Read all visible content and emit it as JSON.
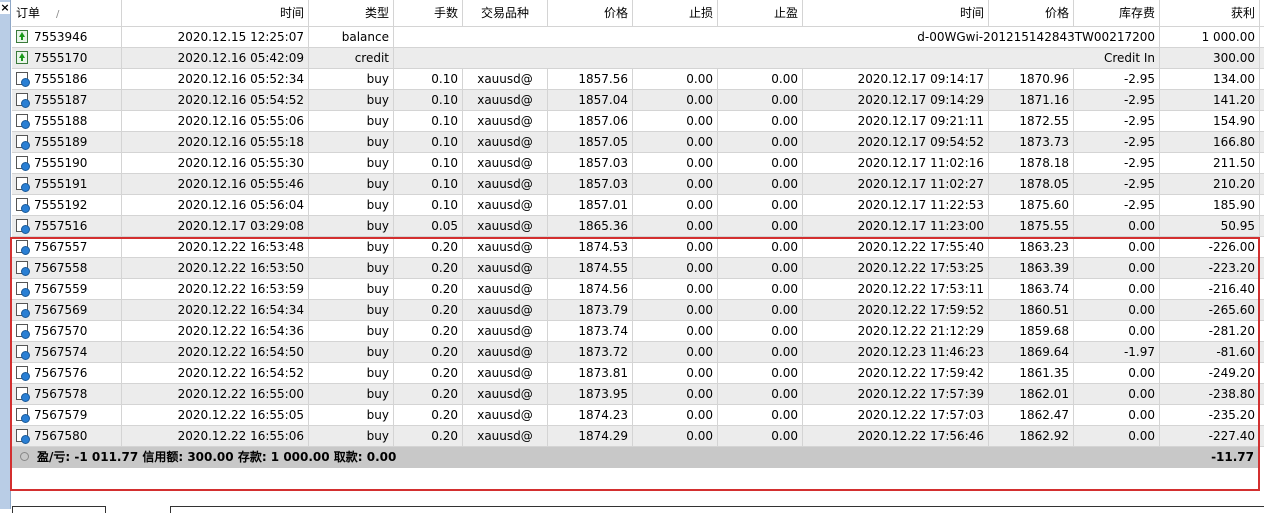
{
  "window": {
    "close_label": "×"
  },
  "columns": [
    "订单",
    "时间",
    "类型",
    "手数",
    "交易品种",
    "价格",
    "止损",
    "止盈",
    "时间",
    "价格",
    "库存费",
    "获利"
  ],
  "sort_indicator": "/",
  "rows": [
    {
      "icon": "deposit-icon",
      "order": "7553946",
      "time": "2020.12.15 12:25:07",
      "type": "balance",
      "comment": "d-00WGwi-201215142843TW00217200",
      "profit": "1 000.00"
    },
    {
      "icon": "deposit-icon",
      "order": "7555170",
      "time": "2020.12.16 05:42:09",
      "type": "credit",
      "comment": "Credit In",
      "profit": "300.00"
    },
    {
      "icon": "order-icon",
      "order": "7555186",
      "time": "2020.12.16 05:52:34",
      "type": "buy",
      "lots": "0.10",
      "symbol": "xauusd@",
      "price": "1857.56",
      "sl": "0.00",
      "tp": "0.00",
      "close_time": "2020.12.17 09:14:17",
      "close_price": "1870.96",
      "swap": "-2.95",
      "profit": "134.00"
    },
    {
      "icon": "order-icon",
      "order": "7555187",
      "time": "2020.12.16 05:54:52",
      "type": "buy",
      "lots": "0.10",
      "symbol": "xauusd@",
      "price": "1857.04",
      "sl": "0.00",
      "tp": "0.00",
      "close_time": "2020.12.17 09:14:29",
      "close_price": "1871.16",
      "swap": "-2.95",
      "profit": "141.20"
    },
    {
      "icon": "order-icon",
      "order": "7555188",
      "time": "2020.12.16 05:55:06",
      "type": "buy",
      "lots": "0.10",
      "symbol": "xauusd@",
      "price": "1857.06",
      "sl": "0.00",
      "tp": "0.00",
      "close_time": "2020.12.17 09:21:11",
      "close_price": "1872.55",
      "swap": "-2.95",
      "profit": "154.90"
    },
    {
      "icon": "order-icon",
      "order": "7555189",
      "time": "2020.12.16 05:55:18",
      "type": "buy",
      "lots": "0.10",
      "symbol": "xauusd@",
      "price": "1857.05",
      "sl": "0.00",
      "tp": "0.00",
      "close_time": "2020.12.17 09:54:52",
      "close_price": "1873.73",
      "swap": "-2.95",
      "profit": "166.80"
    },
    {
      "icon": "order-icon",
      "order": "7555190",
      "time": "2020.12.16 05:55:30",
      "type": "buy",
      "lots": "0.10",
      "symbol": "xauusd@",
      "price": "1857.03",
      "sl": "0.00",
      "tp": "0.00",
      "close_time": "2020.12.17 11:02:16",
      "close_price": "1878.18",
      "swap": "-2.95",
      "profit": "211.50"
    },
    {
      "icon": "order-icon",
      "order": "7555191",
      "time": "2020.12.16 05:55:46",
      "type": "buy",
      "lots": "0.10",
      "symbol": "xauusd@",
      "price": "1857.03",
      "sl": "0.00",
      "tp": "0.00",
      "close_time": "2020.12.17 11:02:27",
      "close_price": "1878.05",
      "swap": "-2.95",
      "profit": "210.20"
    },
    {
      "icon": "order-icon",
      "order": "7555192",
      "time": "2020.12.16 05:56:04",
      "type": "buy",
      "lots": "0.10",
      "symbol": "xauusd@",
      "price": "1857.01",
      "sl": "0.00",
      "tp": "0.00",
      "close_time": "2020.12.17 11:22:53",
      "close_price": "1875.60",
      "swap": "-2.95",
      "profit": "185.90"
    },
    {
      "icon": "order-icon",
      "order": "7557516",
      "time": "2020.12.17 03:29:08",
      "type": "buy",
      "lots": "0.05",
      "symbol": "xauusd@",
      "price": "1865.36",
      "sl": "0.00",
      "tp": "0.00",
      "close_time": "2020.12.17 11:23:00",
      "close_price": "1875.55",
      "swap": "0.00",
      "profit": "50.95"
    },
    {
      "icon": "order-icon",
      "order": "7567557",
      "time": "2020.12.22 16:53:48",
      "type": "buy",
      "lots": "0.20",
      "symbol": "xauusd@",
      "price": "1874.53",
      "sl": "0.00",
      "tp": "0.00",
      "close_time": "2020.12.22 17:55:40",
      "close_price": "1863.23",
      "swap": "0.00",
      "profit": "-226.00"
    },
    {
      "icon": "order-icon",
      "order": "7567558",
      "time": "2020.12.22 16:53:50",
      "type": "buy",
      "lots": "0.20",
      "symbol": "xauusd@",
      "price": "1874.55",
      "sl": "0.00",
      "tp": "0.00",
      "close_time": "2020.12.22 17:53:25",
      "close_price": "1863.39",
      "swap": "0.00",
      "profit": "-223.20"
    },
    {
      "icon": "order-icon",
      "order": "7567559",
      "time": "2020.12.22 16:53:59",
      "type": "buy",
      "lots": "0.20",
      "symbol": "xauusd@",
      "price": "1874.56",
      "sl": "0.00",
      "tp": "0.00",
      "close_time": "2020.12.22 17:53:11",
      "close_price": "1863.74",
      "swap": "0.00",
      "profit": "-216.40"
    },
    {
      "icon": "order-icon",
      "order": "7567569",
      "time": "2020.12.22 16:54:34",
      "type": "buy",
      "lots": "0.20",
      "symbol": "xauusd@",
      "price": "1873.79",
      "sl": "0.00",
      "tp": "0.00",
      "close_time": "2020.12.22 17:59:52",
      "close_price": "1860.51",
      "swap": "0.00",
      "profit": "-265.60"
    },
    {
      "icon": "order-icon",
      "order": "7567570",
      "time": "2020.12.22 16:54:36",
      "type": "buy",
      "lots": "0.20",
      "symbol": "xauusd@",
      "price": "1873.74",
      "sl": "0.00",
      "tp": "0.00",
      "close_time": "2020.12.22 21:12:29",
      "close_price": "1859.68",
      "swap": "0.00",
      "profit": "-281.20"
    },
    {
      "icon": "order-icon",
      "order": "7567574",
      "time": "2020.12.22 16:54:50",
      "type": "buy",
      "lots": "0.20",
      "symbol": "xauusd@",
      "price": "1873.72",
      "sl": "0.00",
      "tp": "0.00",
      "close_time": "2020.12.23 11:46:23",
      "close_price": "1869.64",
      "swap": "-1.97",
      "profit": "-81.60"
    },
    {
      "icon": "order-icon",
      "order": "7567576",
      "time": "2020.12.22 16:54:52",
      "type": "buy",
      "lots": "0.20",
      "symbol": "xauusd@",
      "price": "1873.81",
      "sl": "0.00",
      "tp": "0.00",
      "close_time": "2020.12.22 17:59:42",
      "close_price": "1861.35",
      "swap": "0.00",
      "profit": "-249.20"
    },
    {
      "icon": "order-icon",
      "order": "7567578",
      "time": "2020.12.22 16:55:00",
      "type": "buy",
      "lots": "0.20",
      "symbol": "xauusd@",
      "price": "1873.95",
      "sl": "0.00",
      "tp": "0.00",
      "close_time": "2020.12.22 17:57:39",
      "close_price": "1862.01",
      "swap": "0.00",
      "profit": "-238.80"
    },
    {
      "icon": "order-icon",
      "order": "7567579",
      "time": "2020.12.22 16:55:05",
      "type": "buy",
      "lots": "0.20",
      "symbol": "xauusd@",
      "price": "1874.23",
      "sl": "0.00",
      "tp": "0.00",
      "close_time": "2020.12.22 17:57:03",
      "close_price": "1862.47",
      "swap": "0.00",
      "profit": "-235.20"
    },
    {
      "icon": "order-icon",
      "order": "7567580",
      "time": "2020.12.22 16:55:06",
      "type": "buy",
      "lots": "0.20",
      "symbol": "xauusd@",
      "price": "1874.29",
      "sl": "0.00",
      "tp": "0.00",
      "close_time": "2020.12.22 17:56:46",
      "close_price": "1862.92",
      "swap": "0.00",
      "profit": "-227.40"
    }
  ],
  "summary": {
    "text": "盈/亏: -1 011.77  信用额: 300.00  存款: 1 000.00  取款: 0.00",
    "total": "-11.77"
  },
  "colors": {
    "highlight_box": "#d32f2f",
    "row_alt": "#ececec",
    "summary_bg": "#c8c8c8"
  }
}
